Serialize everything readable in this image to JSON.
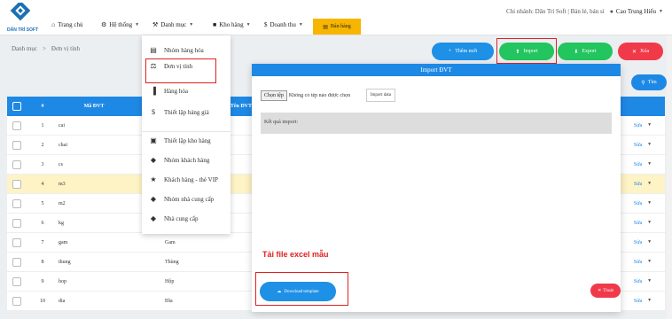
{
  "brand": {
    "logo_text": "DÂN TRÍ SOFT",
    "logo_color": "#1b6fb5"
  },
  "nav": {
    "home": "Trang chủ",
    "system": "Hệ thống",
    "category": "Danh mục",
    "warehouse": "Kho hàng",
    "revenue": "Doanh thu",
    "sales": "Bán hàng"
  },
  "header": {
    "branch": "Chi nhánh: Dân Trí Soft | Bán lẻ, bán sỉ",
    "user": "Cao Trung Hiếu"
  },
  "breadcrumb": {
    "root": "Danh mục",
    "sep": ">",
    "current": "Đơn vị tính"
  },
  "actions": {
    "add": "Thêm mới",
    "import": "Import",
    "export": "Export",
    "delete": "Xóa",
    "search": "Tìm"
  },
  "dropdown": [
    {
      "label": "Nhóm hàng hóa",
      "icon": "list-icon"
    },
    {
      "label": "Đơn vị tính",
      "icon": "scale-icon"
    },
    {
      "label": "Hàng hóa",
      "icon": "barcode-icon"
    },
    {
      "label": "Thiết lập bảng giá",
      "icon": "dollar-icon"
    },
    {
      "label": "Thiết lập kho hàng",
      "icon": "store-icon"
    },
    {
      "label": "Nhóm khách hàng",
      "icon": "tag-icon"
    },
    {
      "label": "Khách hàng - thẻ VIP",
      "icon": "walk-icon"
    },
    {
      "label": "Nhóm nhà cung cấp",
      "icon": "tag-icon"
    },
    {
      "label": "Nhà cung cấp",
      "icon": "tag-icon"
    }
  ],
  "table": {
    "columns": [
      "#",
      "Mã ĐVT",
      "Tên ĐVT"
    ],
    "rows": [
      {
        "num": "1",
        "ma": "cai",
        "ten": ""
      },
      {
        "num": "2",
        "ma": "chai",
        "ten": ""
      },
      {
        "num": "3",
        "ma": "cs",
        "ten": ""
      },
      {
        "num": "4",
        "ma": "m3",
        "ten": ""
      },
      {
        "num": "5",
        "ma": "m2",
        "ten": ""
      },
      {
        "num": "6",
        "ma": "kg",
        "ten": ""
      },
      {
        "num": "7",
        "ma": "gam",
        "ten": "Gam"
      },
      {
        "num": "8",
        "ma": "thung",
        "ten": "Thùng"
      },
      {
        "num": "9",
        "ma": "hop",
        "ten": "Hộp"
      },
      {
        "num": "10",
        "ma": "dia",
        "ten": "Đĩa"
      }
    ],
    "edit_label": "Sửa"
  },
  "modal": {
    "title": "Import ĐVT",
    "choose_file": "Chọn tệp",
    "no_file": "Không có tệp nào được chọn",
    "import_data": "Import data",
    "result_label": "Kết quả import:",
    "template_note": "Tải file excel mẫu",
    "download": "Download template",
    "close": "Thoát"
  }
}
